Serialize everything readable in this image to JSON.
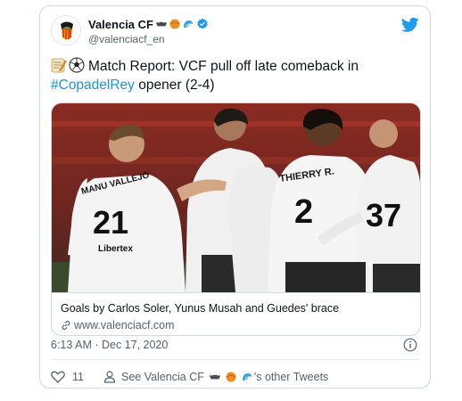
{
  "account": {
    "display_name": "Valencia CF",
    "handle": "@valenciacf_en"
  },
  "tweet": {
    "text_main": "Match Report: VCF pull off late comeback in ",
    "hashtag": "#CopadelRey",
    "text_tail": " opener (2-4)"
  },
  "link_card": {
    "title": "Goals by Carlos Soler, Yunus Musah and Guedes' brace",
    "url": "www.valenciacf.com"
  },
  "photo": {
    "jersey_names": [
      "MANU VALLEJO",
      "THIERRY R."
    ],
    "jersey_numbers": [
      "21",
      "2",
      "37"
    ],
    "sponsor": "Libertex"
  },
  "meta": {
    "timestamp": "6:13 AM · Dec 17, 2020"
  },
  "footer": {
    "like_count": "11",
    "see_prefix": "See Valencia CF",
    "see_suffix": "'s other Tweets"
  },
  "colors": {
    "brand_blue": "#1d9bf0",
    "link_blue": "#1b95e0",
    "secondary_text": "#536471"
  },
  "icons": [
    "bat-emoji",
    "ball-emoji",
    "wave-emoji",
    "verified-badge-icon",
    "twitter-bird-icon",
    "memo-emoji",
    "soccer-ball-emoji",
    "link-icon",
    "info-icon",
    "heart-icon",
    "person-icon"
  ]
}
